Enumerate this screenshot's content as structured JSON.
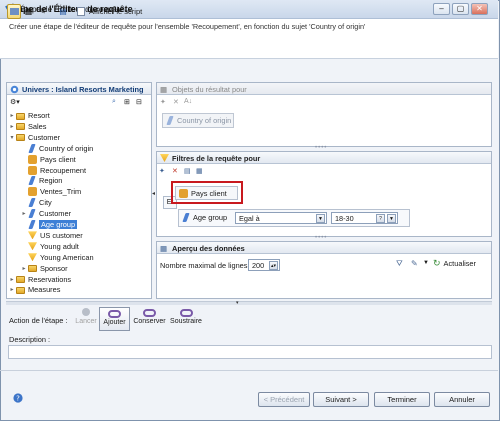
{
  "window": {
    "title": "Étape de l'Éditeur de requête"
  },
  "header": {
    "title": "Étape de l'Éditeur de requête",
    "subtitle": "Créer une étape de l'éditeur de requête pour l'ensemble 'Recoupement', en fonction du sujet 'Country of origin'"
  },
  "toolbar": {
    "show_script": "Afficher le script"
  },
  "universe": {
    "title": "Univers : Island Resorts Marketing",
    "tree": [
      {
        "label": "Resort",
        "kind": "folder",
        "level": 0,
        "twisty": "▸"
      },
      {
        "label": "Sales",
        "kind": "folder",
        "level": 0,
        "twisty": "▸"
      },
      {
        "label": "Customer",
        "kind": "folder",
        "level": 0,
        "twisty": "▾"
      },
      {
        "label": "Country of origin",
        "kind": "dim",
        "level": 1,
        "twisty": ""
      },
      {
        "label": "Pays client",
        "kind": "qf",
        "level": 1,
        "twisty": ""
      },
      {
        "label": "Recoupement",
        "kind": "qf",
        "level": 1,
        "twisty": ""
      },
      {
        "label": "Region",
        "kind": "dim",
        "level": 1,
        "twisty": ""
      },
      {
        "label": "Ventes_Trim",
        "kind": "qf",
        "level": 1,
        "twisty": ""
      },
      {
        "label": "City",
        "kind": "dim",
        "level": 1,
        "twisty": ""
      },
      {
        "label": "Customer",
        "kind": "dim",
        "level": 1,
        "twisty": "▸"
      },
      {
        "label": "Age group",
        "kind": "dim",
        "level": 1,
        "twisty": "",
        "selected": true
      },
      {
        "label": "US customer",
        "kind": "meas",
        "level": 1,
        "twisty": ""
      },
      {
        "label": "Young adult",
        "kind": "meas",
        "level": 1,
        "twisty": ""
      },
      {
        "label": "Young American",
        "kind": "meas",
        "level": 1,
        "twisty": ""
      },
      {
        "label": "Sponsor",
        "kind": "folder",
        "level": 1,
        "twisty": "▸"
      },
      {
        "label": "Reservations",
        "kind": "folder",
        "level": 0,
        "twisty": "▸"
      },
      {
        "label": "Measures",
        "kind": "folder",
        "level": 0,
        "twisty": "▸"
      }
    ]
  },
  "result_objects": {
    "title": "Objets du résultat pour",
    "chip": "Country of origin"
  },
  "filters": {
    "title": "Filtres de la requête pour",
    "and_label": "Et",
    "chip": "Pays client",
    "row": {
      "object": "Age group",
      "operator": "Egal à",
      "value": "18-30"
    }
  },
  "preview": {
    "title": "Aperçu des données",
    "max_rows_label": "Nombre maximal de lignes",
    "max_rows_value": "200",
    "refresh": "Actualiser"
  },
  "step_action": {
    "label": "Action de l'étape :",
    "buttons": [
      "Lancer",
      "Ajouter",
      "Conserver",
      "Soustraire"
    ]
  },
  "description": {
    "label": "Description :"
  },
  "footer": {
    "prev": "< Précédent",
    "next": "Suivant >",
    "finish": "Terminer",
    "cancel": "Annuler"
  }
}
